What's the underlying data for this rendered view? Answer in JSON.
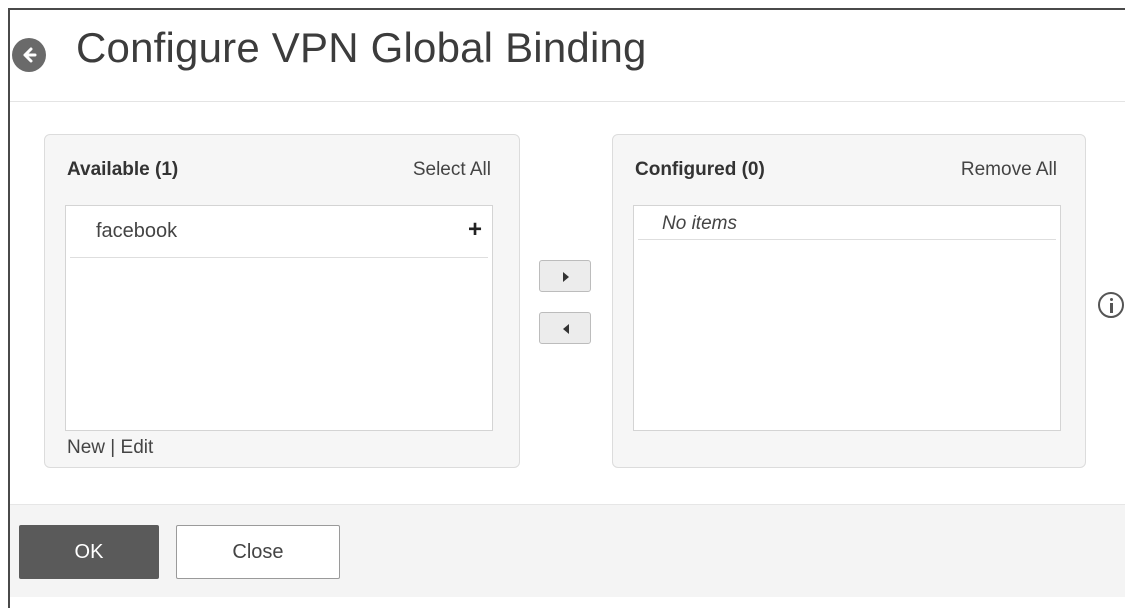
{
  "header": {
    "title": "Configure VPN Global Binding",
    "back_icon": "arrow-left-circle-icon"
  },
  "available": {
    "title": "Available (1)",
    "action_label": "Select All",
    "items": [
      {
        "label": "facebook",
        "add_glyph": "+"
      }
    ],
    "new_label": "New",
    "separator": "|",
    "edit_label": "Edit"
  },
  "configured": {
    "title": "Configured (0)",
    "action_label": "Remove All",
    "empty_text": "No items"
  },
  "transfer": {
    "add_icon": "triangle-right-icon",
    "remove_icon": "triangle-left-icon"
  },
  "info_icon": "info-circle-icon",
  "footer": {
    "ok_label": "OK",
    "close_label": "Close"
  },
  "colors": {
    "primary_button": "#5a5a5a",
    "panel_bg": "#f6f6f6",
    "title_text": "#3c3c3c"
  }
}
